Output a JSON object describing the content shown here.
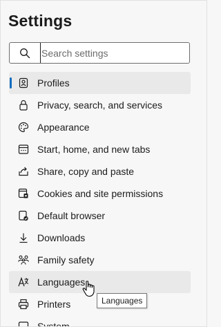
{
  "header": {
    "title": "Settings"
  },
  "search": {
    "placeholder": "Search settings",
    "value": ""
  },
  "sidebar": {
    "items": [
      {
        "label": "Profiles",
        "icon": "profile-icon",
        "selected": true
      },
      {
        "label": "Privacy, search, and services",
        "icon": "lock-icon"
      },
      {
        "label": "Appearance",
        "icon": "palette-icon"
      },
      {
        "label": "Start, home, and new tabs",
        "icon": "home-tabs-icon"
      },
      {
        "label": "Share, copy and paste",
        "icon": "share-icon"
      },
      {
        "label": "Cookies and site permissions",
        "icon": "site-permissions-icon"
      },
      {
        "label": "Default browser",
        "icon": "default-browser-icon"
      },
      {
        "label": "Downloads",
        "icon": "download-icon"
      },
      {
        "label": "Family safety",
        "icon": "family-icon"
      },
      {
        "label": "Languages",
        "icon": "language-icon",
        "hovered": true
      },
      {
        "label": "Printers",
        "icon": "printer-icon"
      },
      {
        "label": "System",
        "icon": "system-icon"
      }
    ]
  },
  "tooltip": {
    "text": "Languages"
  },
  "colors": {
    "accent": "#0f6cbd",
    "selected_bg": "#e9e9e9",
    "page_bg": "#f7f7f7"
  }
}
